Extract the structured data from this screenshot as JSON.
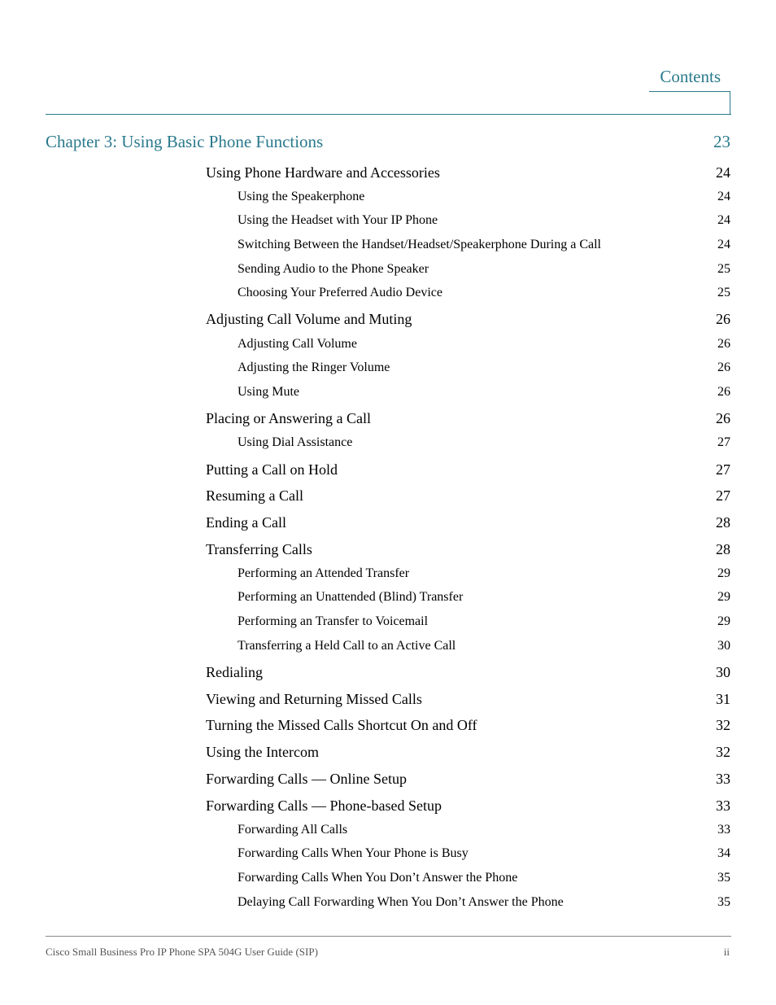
{
  "header": {
    "title": "Contents"
  },
  "chapter": {
    "title": "Chapter 3: Using Basic Phone Functions",
    "page": "23"
  },
  "entries": [
    {
      "level": 1,
      "label": "Using Phone Hardware and Accessories",
      "page": "24"
    },
    {
      "level": 2,
      "label": "Using the Speakerphone",
      "page": "24"
    },
    {
      "level": 2,
      "label": "Using the Headset with Your IP Phone",
      "page": "24"
    },
    {
      "level": 2,
      "label": "Switching Between the Handset/Headset/Speakerphone During a Call",
      "page": "24"
    },
    {
      "level": 2,
      "label": "Sending Audio to the Phone Speaker",
      "page": "25"
    },
    {
      "level": 2,
      "label": "Choosing Your Preferred Audio Device",
      "page": "25"
    },
    {
      "level": 1,
      "label": "Adjusting Call Volume and Muting",
      "page": "26"
    },
    {
      "level": 2,
      "label": "Adjusting Call Volume",
      "page": "26"
    },
    {
      "level": 2,
      "label": "Adjusting the Ringer Volume",
      "page": "26"
    },
    {
      "level": 2,
      "label": "Using Mute",
      "page": "26"
    },
    {
      "level": 1,
      "label": "Placing or Answering a Call",
      "page": "26"
    },
    {
      "level": 2,
      "label": "Using Dial Assistance",
      "page": "27"
    },
    {
      "level": 1,
      "label": "Putting a Call on Hold",
      "page": "27"
    },
    {
      "level": 1,
      "label": "Resuming a Call",
      "page": "27"
    },
    {
      "level": 1,
      "label": "Ending a Call",
      "page": "28"
    },
    {
      "level": 1,
      "label": "Transferring Calls",
      "page": "28"
    },
    {
      "level": 2,
      "label": "Performing an Attended Transfer",
      "page": "29"
    },
    {
      "level": 2,
      "label": "Performing an Unattended (Blind) Transfer",
      "page": "29"
    },
    {
      "level": 2,
      "label": "Performing an Transfer to Voicemail",
      "page": "29"
    },
    {
      "level": 2,
      "label": "Transferring a Held Call to an Active Call",
      "page": "30"
    },
    {
      "level": 1,
      "label": "Redialing",
      "page": "30"
    },
    {
      "level": 1,
      "label": "Viewing and Returning Missed Calls",
      "page": "31"
    },
    {
      "level": 1,
      "label": "Turning the Missed Calls Shortcut On and Off",
      "page": "32"
    },
    {
      "level": 1,
      "label": "Using the Intercom",
      "page": "32"
    },
    {
      "level": 1,
      "label": "Forwarding Calls — Online Setup",
      "page": "33"
    },
    {
      "level": 1,
      "label": "Forwarding Calls — Phone-based Setup",
      "page": "33"
    },
    {
      "level": 2,
      "label": "Forwarding All Calls",
      "page": "33"
    },
    {
      "level": 2,
      "label": "Forwarding Calls When Your Phone is Busy",
      "page": "34"
    },
    {
      "level": 2,
      "label": "Forwarding Calls When You Don’t Answer the Phone",
      "page": "35"
    },
    {
      "level": 2,
      "label": "Delaying Call Forwarding When You Don’t Answer the Phone",
      "page": "35"
    }
  ],
  "footer": {
    "text": "Cisco Small Business Pro IP Phone SPA 504G User Guide (SIP)",
    "page": "ii"
  },
  "colors": {
    "accent": "#2a7a8c"
  }
}
